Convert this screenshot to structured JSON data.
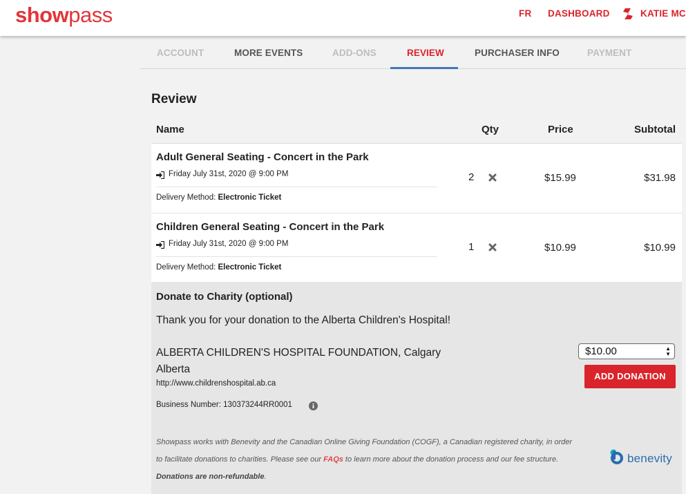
{
  "brand": {
    "bold": "show",
    "light": "pass",
    "color": "#e3343a"
  },
  "nav": {
    "lang": "FR",
    "dashboard": "DASHBOARD",
    "user": "KATIE MCI",
    "user_icon": "showpass-s-icon"
  },
  "tabs": [
    {
      "label": "ACCOUNT",
      "state": "disabled"
    },
    {
      "label": "MORE EVENTS",
      "state": "enabled"
    },
    {
      "label": "ADD-ONS",
      "state": "disabled"
    },
    {
      "label": "REVIEW",
      "state": "active"
    },
    {
      "label": "PURCHASER INFO",
      "state": "enabled"
    },
    {
      "label": "PAYMENT",
      "state": "disabled"
    }
  ],
  "review": {
    "title": "Review",
    "headers": {
      "name": "Name",
      "qty": "Qty",
      "price": "Price",
      "subtotal": "Subtotal"
    },
    "items": [
      {
        "title": "Adult General Seating - Concert in the Park",
        "date": "Friday July 31st, 2020 @ 9:00 PM",
        "delivery_label": "Delivery Method: ",
        "delivery_value": "Electronic Ticket",
        "qty": "2",
        "price": "$15.99",
        "subtotal": "$31.98"
      },
      {
        "title": "Children General Seating - Concert in the Park",
        "date": "Friday July 31st, 2020 @ 9:00 PM",
        "delivery_label": "Delivery Method: ",
        "delivery_value": "Electronic Ticket",
        "qty": "1",
        "price": "$10.99",
        "subtotal": "$10.99"
      }
    ]
  },
  "donation": {
    "title": "Donate to Charity (optional)",
    "thanks": "Thank you for your donation to the Alberta Children's Hospital!",
    "org_line1": "ALBERTA CHILDREN'S HOSPITAL FOUNDATION, Calgary",
    "org_line2": "Alberta",
    "url": "http://www.childrenshospital.ab.ca",
    "business_number": "Business Number: 130373244RR0001",
    "amount": "$10.00",
    "button": "ADD DONATION",
    "disclaimer_1": "Showpass works with Benevity and the Canadian Online Giving Foundation (COGF), a Canadian registered charity, in order to facilitate donations to charities. Please see our ",
    "faq": "FAQs",
    "disclaimer_2": " to learn more about the donation process and our fee structure. ",
    "non_refundable": "Donations are non-refundable",
    "disclaimer_end": ".",
    "partner": "benevity"
  },
  "colors": {
    "accent": "#d9242b",
    "tab_underline": "#3f79b7",
    "benevity_blue": "#2a6cb0"
  }
}
